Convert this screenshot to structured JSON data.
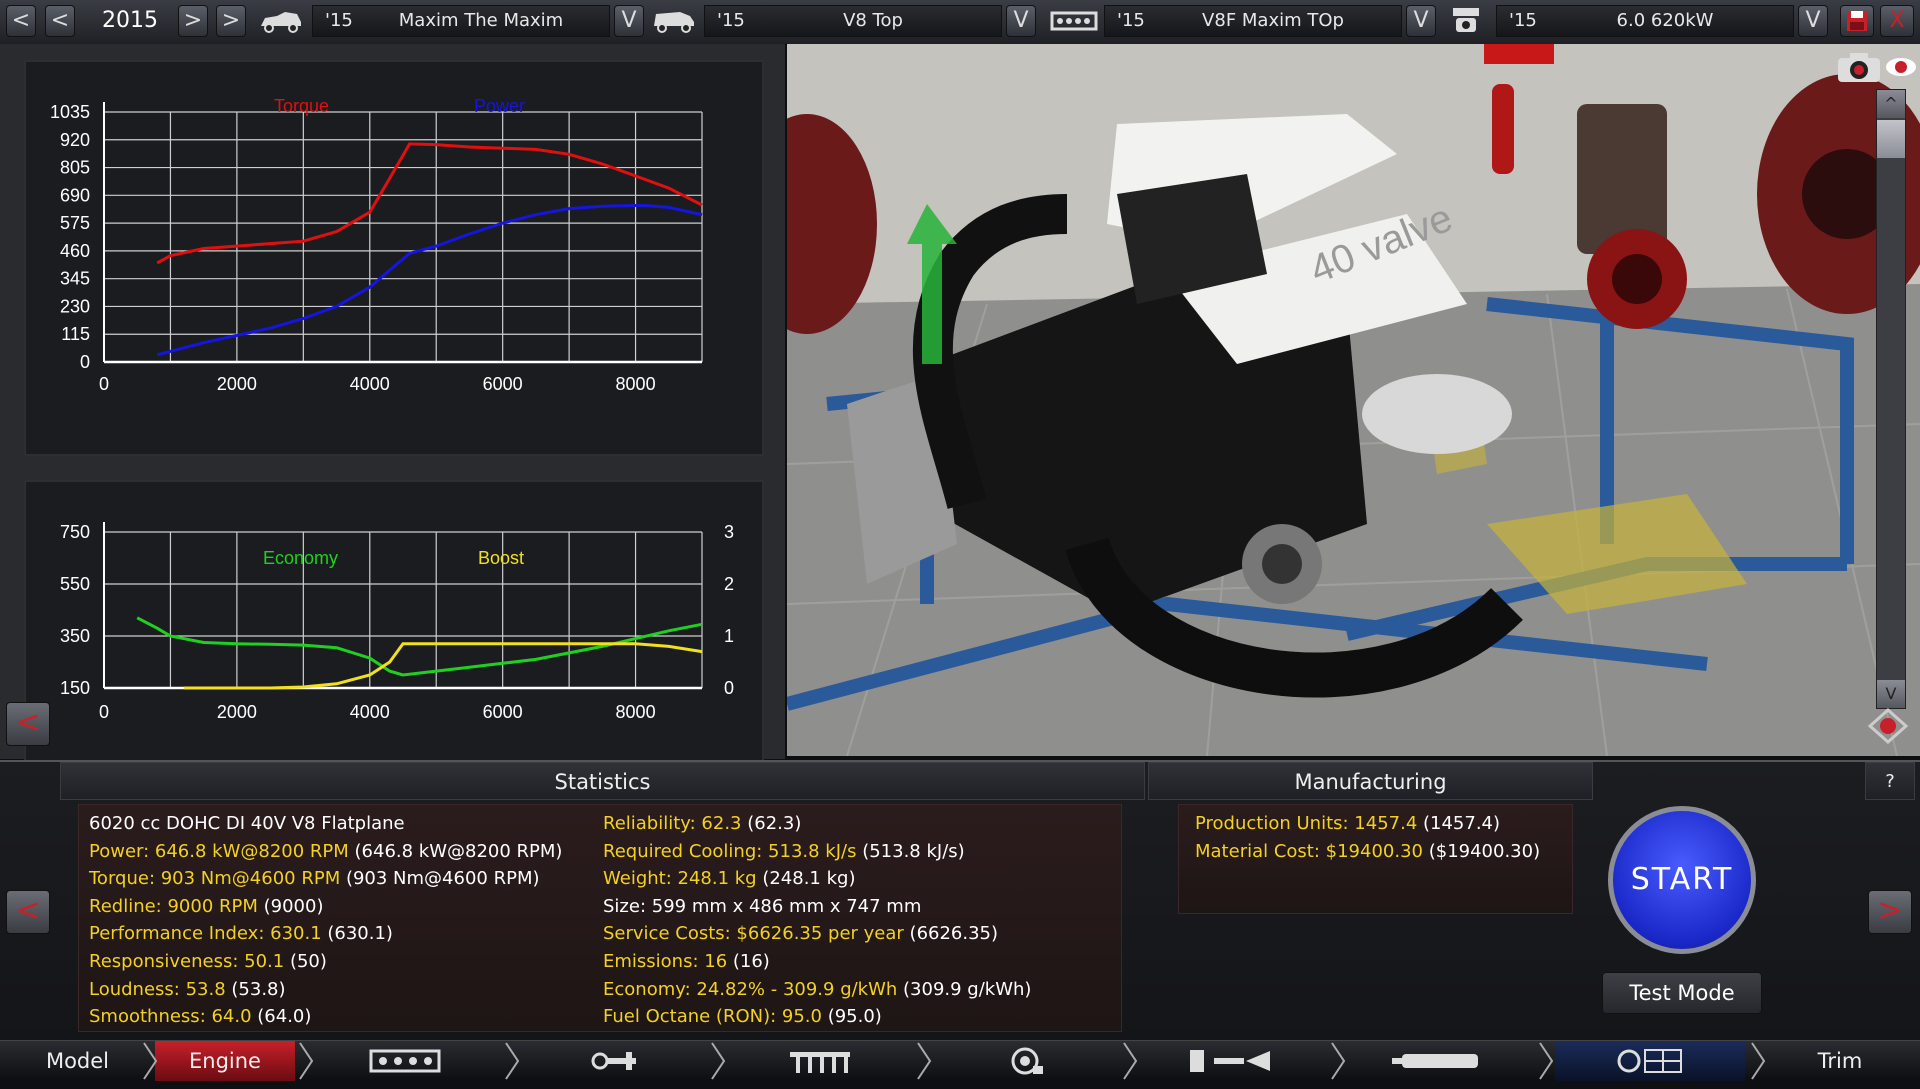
{
  "topbar": {
    "year": "2015",
    "model": {
      "year": "'15",
      "name": "Maxim The Maxim"
    },
    "trim": {
      "year": "'15",
      "name": "V8 Top"
    },
    "engine": {
      "year": "'15",
      "name": "V8F Maxim TOp"
    },
    "variant": {
      "year": "'15",
      "name": "6.0 620kW"
    },
    "dropdown_glyph": "V",
    "prev_glyph": "<",
    "next_glyph": ">",
    "close_glyph": "X"
  },
  "graph_top": {
    "legend": {
      "torque": "Torque",
      "power": "Power"
    },
    "y_ticks": [
      "1035",
      "920",
      "805",
      "690",
      "575",
      "460",
      "345",
      "230",
      "115",
      "0"
    ],
    "x_ticks": [
      "0",
      "2000",
      "4000",
      "6000",
      "8000"
    ]
  },
  "graph_bottom": {
    "legend": {
      "economy": "Economy",
      "boost": "Boost"
    },
    "y_ticks_left": [
      "750",
      "550",
      "350",
      "150"
    ],
    "y_ticks_right": [
      "3",
      "2",
      "1",
      "0"
    ],
    "x_ticks": [
      "0",
      "2000",
      "4000",
      "6000",
      "8000"
    ]
  },
  "chart_data": [
    {
      "type": "line",
      "xlim": [
        0,
        9000
      ],
      "ylim": [
        0,
        1035
      ],
      "grid": true,
      "series": [
        {
          "name": "Torque",
          "color": "#e01010",
          "x": [
            800,
            1000,
            1500,
            2000,
            2500,
            3000,
            3500,
            4000,
            4300,
            4600,
            5000,
            5500,
            6000,
            6500,
            7000,
            7500,
            8000,
            8500,
            9000
          ],
          "y": [
            410,
            440,
            470,
            480,
            490,
            500,
            540,
            620,
            760,
            903,
            900,
            890,
            885,
            880,
            860,
            820,
            770,
            720,
            650
          ]
        },
        {
          "name": "Power",
          "color": "#1515e0",
          "x": [
            800,
            1500,
            2000,
            2500,
            3000,
            3500,
            4000,
            4300,
            4600,
            5000,
            5500,
            6000,
            6500,
            7000,
            7500,
            8000,
            8200,
            8500,
            9000
          ],
          "y": [
            30,
            80,
            110,
            140,
            180,
            230,
            310,
            380,
            450,
            480,
            530,
            575,
            610,
            635,
            645,
            648,
            647,
            640,
            610
          ]
        }
      ]
    },
    {
      "type": "line",
      "xlim": [
        0,
        9000
      ],
      "ylim": [
        150,
        750
      ],
      "y2lim": [
        0,
        3
      ],
      "grid": true,
      "series": [
        {
          "name": "Economy",
          "color": "#20d020",
          "axis": "left",
          "x": [
            500,
            800,
            1000,
            1500,
            2000,
            2500,
            3000,
            3500,
            4000,
            4300,
            4500,
            5000,
            5500,
            6000,
            6500,
            7000,
            7500,
            8000,
            8500,
            9000
          ],
          "y": [
            420,
            380,
            350,
            325,
            320,
            318,
            315,
            305,
            265,
            215,
            200,
            215,
            230,
            245,
            260,
            285,
            310,
            340,
            370,
            395
          ]
        },
        {
          "name": "Boost",
          "color": "#f0e020",
          "axis": "right",
          "x": [
            1200,
            2000,
            2500,
            3000,
            3500,
            4000,
            4300,
            4500,
            5000,
            6000,
            7000,
            8000,
            8500,
            9000
          ],
          "y": [
            0,
            0,
            0,
            0.02,
            0.08,
            0.25,
            0.5,
            0.85,
            0.85,
            0.85,
            0.85,
            0.85,
            0.8,
            0.7
          ]
        }
      ]
    }
  ],
  "view": {
    "sign_text": "",
    "engine_badge": "40 valve"
  },
  "statistics": {
    "title": "Statistics",
    "left": [
      {
        "label": "6020 cc DOHC DI 40V V8 Flatplane",
        "paren": ""
      },
      {
        "label": "Power: 646.8 kW@8200 RPM",
        "paren": "(646.8 kW@8200 RPM)"
      },
      {
        "label": "Torque: 903 Nm@4600 RPM",
        "paren": "(903 Nm@4600 RPM)"
      },
      {
        "label": "Redline: 9000 RPM",
        "paren": "(9000)"
      },
      {
        "label": "Performance Index: 630.1",
        "paren": "(630.1)"
      },
      {
        "label": "Responsiveness: 50.1",
        "paren": "(50)"
      },
      {
        "label": "Loudness: 53.8",
        "paren": "(53.8)"
      },
      {
        "label": "Smoothness: 64.0",
        "paren": "(64.0)"
      }
    ],
    "right": [
      {
        "label": "Reliability: 62.3",
        "paren": "(62.3)"
      },
      {
        "label": "Required Cooling: 513.8 kJ/s",
        "paren": "(513.8 kJ/s)"
      },
      {
        "label": "Weight: 248.1 kg",
        "paren": "(248.1 kg)"
      },
      {
        "label": "Size: 599 mm x 486 mm x 747 mm",
        "paren": ""
      },
      {
        "label": "Service Costs: $6626.35 per year",
        "paren": "(6626.35)"
      },
      {
        "label": "Emissions: 16",
        "paren": "(16)"
      },
      {
        "label": "Economy: 24.82% - 309.9 g/kWh",
        "paren": "(309.9 g/kWh)"
      },
      {
        "label": "Fuel Octane (RON): 95.0",
        "paren": "(95.0)"
      }
    ]
  },
  "manufacturing": {
    "title": "Manufacturing",
    "lines": [
      {
        "label": "Production Units: 1457.4",
        "paren": "(1457.4)"
      },
      {
        "label": "Material Cost: $19400.30",
        "paren": "($19400.30)"
      }
    ]
  },
  "actions": {
    "start": "START",
    "test_mode": "Test Mode",
    "help": "?"
  },
  "nav": {
    "model": "Model",
    "engine": "Engine",
    "trim": "Trim"
  },
  "colors": {
    "accent_red": "#c8202a",
    "stat_yellow": "#f2d024",
    "start_blue": "#2a3ee0"
  }
}
